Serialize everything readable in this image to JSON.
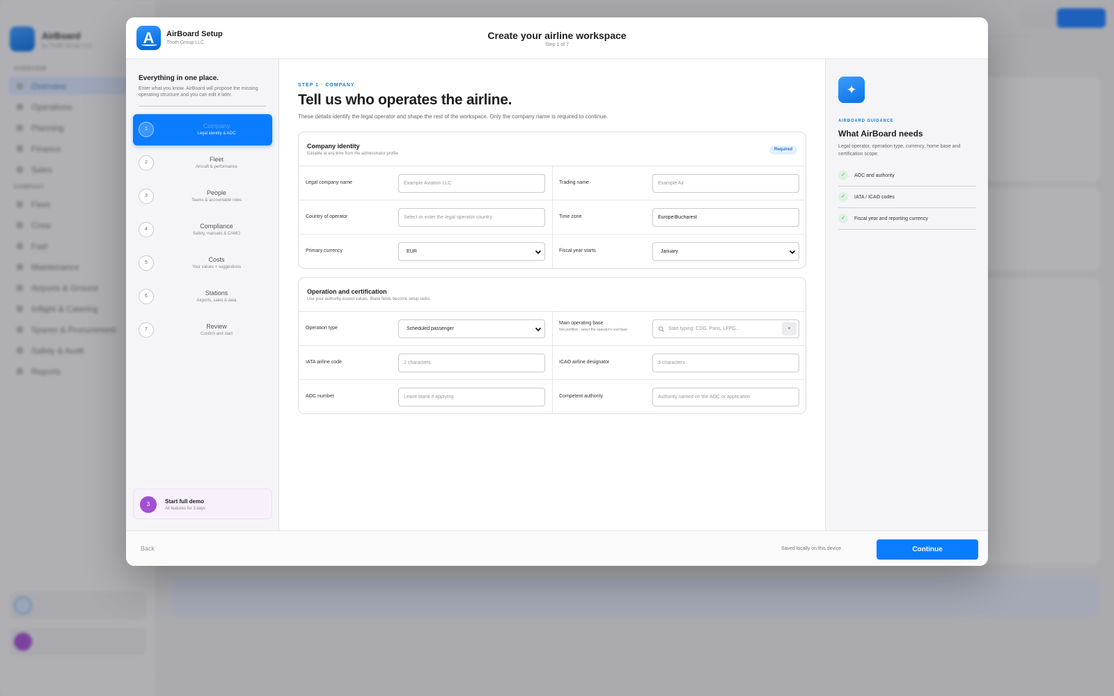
{
  "background": {
    "brand": "AirBoard",
    "brand_sub": "by Thoth Group LLC",
    "section_overview": "OVERVIEW",
    "section_company": "COMPANY",
    "nav": [
      "Overview",
      "Operations",
      "Planning",
      "Finance",
      "Sales"
    ],
    "nav2": [
      "Fleet",
      "Crew",
      "Fuel",
      "Maintenance",
      "Airports & Ground",
      "Inflight & Catering",
      "Spares & Procurement",
      "Safety & Audit",
      "Reports"
    ]
  },
  "modal": {
    "app_name": "AirBoard Setup",
    "app_org": "Thoth Group LLC",
    "app_icon_letter": "A",
    "title": "Create your airline workspace",
    "step_text": "Step 1 of 7"
  },
  "rail": {
    "heading": "Everything in one place.",
    "description": "Enter what you know. AirBoard will propose the missing operating structure and you can edit it later.",
    "steps": [
      {
        "num": "1",
        "label": "Company",
        "sub": "Legal identity & AOC"
      },
      {
        "num": "2",
        "label": "Fleet",
        "sub": "Aircraft & performance"
      },
      {
        "num": "3",
        "label": "People",
        "sub": "Teams & accountable roles"
      },
      {
        "num": "4",
        "label": "Compliance",
        "sub": "Safety, manuals & CAMO"
      },
      {
        "num": "5",
        "label": "Costs",
        "sub": "Your values + suggestions"
      },
      {
        "num": "6",
        "label": "Stations",
        "sub": "Airports, sales & data"
      },
      {
        "num": "7",
        "label": "Review",
        "sub": "Confirm and start"
      }
    ],
    "demo": {
      "badge": "3",
      "title": "Start full demo",
      "sub": "All features for 3 days"
    }
  },
  "content": {
    "eyebrow": "STEP 1 · COMPANY",
    "heading": "Tell us who operates the airline.",
    "lead": "These details identify the legal operator and shape the rest of the workspace. Only the company name is required to continue.",
    "identity": {
      "title": "Company identity",
      "sub": "Editable at any time from the administrator profile.",
      "badge": "Required",
      "legal_name_label": "Legal company name",
      "legal_name_placeholder": "Example Aviation LLC",
      "trading_name_label": "Trading name",
      "trading_name_placeholder": "Example Air",
      "country_label": "Country of operator",
      "country_placeholder": "Select or enter the legal operator country",
      "timezone_label": "Time zone",
      "timezone_value": "Europe/Bucharest",
      "currency_label": "Primary currency",
      "currency_value": "EUR",
      "fiscal_label": "Fiscal year starts",
      "fiscal_value": "January"
    },
    "operation": {
      "title": "Operation and certification",
      "sub": "Use your authority-issued values. Blank fields become setup tasks.",
      "type_label": "Operation type",
      "type_value": "Scheduled passenger",
      "base_label": "Main operating base",
      "base_hint": "Not prefilled · select the operator's real base",
      "base_placeholder": "Start typing: CDG, Paris, LFPG...",
      "clear_label": "×",
      "iata_label": "IATA airline code",
      "iata_placeholder": "2 characters",
      "icao_label": "ICAO airline designator",
      "icao_placeholder": "3 characters",
      "aoc_label": "AOC number",
      "aoc_placeholder": "Leave blank if applying",
      "authority_label": "Competent authority",
      "authority_placeholder": "Authority named on the AOC or application"
    }
  },
  "guide": {
    "icon": "✦",
    "eyebrow": "AIRBOARD GUIDANCE",
    "title": "What AirBoard needs",
    "description": "Legal operator, operation type, currency, home base and certification scope.",
    "items": [
      "AOC and authority",
      "IATA / ICAO codes",
      "Fiscal year and reporting currency"
    ],
    "check": "✓"
  },
  "footer": {
    "back": "Back",
    "saved": "Saved locally on this device",
    "continue": "Continue"
  },
  "colors": {
    "accent": "#0a7cff",
    "eyebrow": "#1d7bd6",
    "demo_badge": "#a24fd3",
    "check_green": "#3aa55a"
  }
}
